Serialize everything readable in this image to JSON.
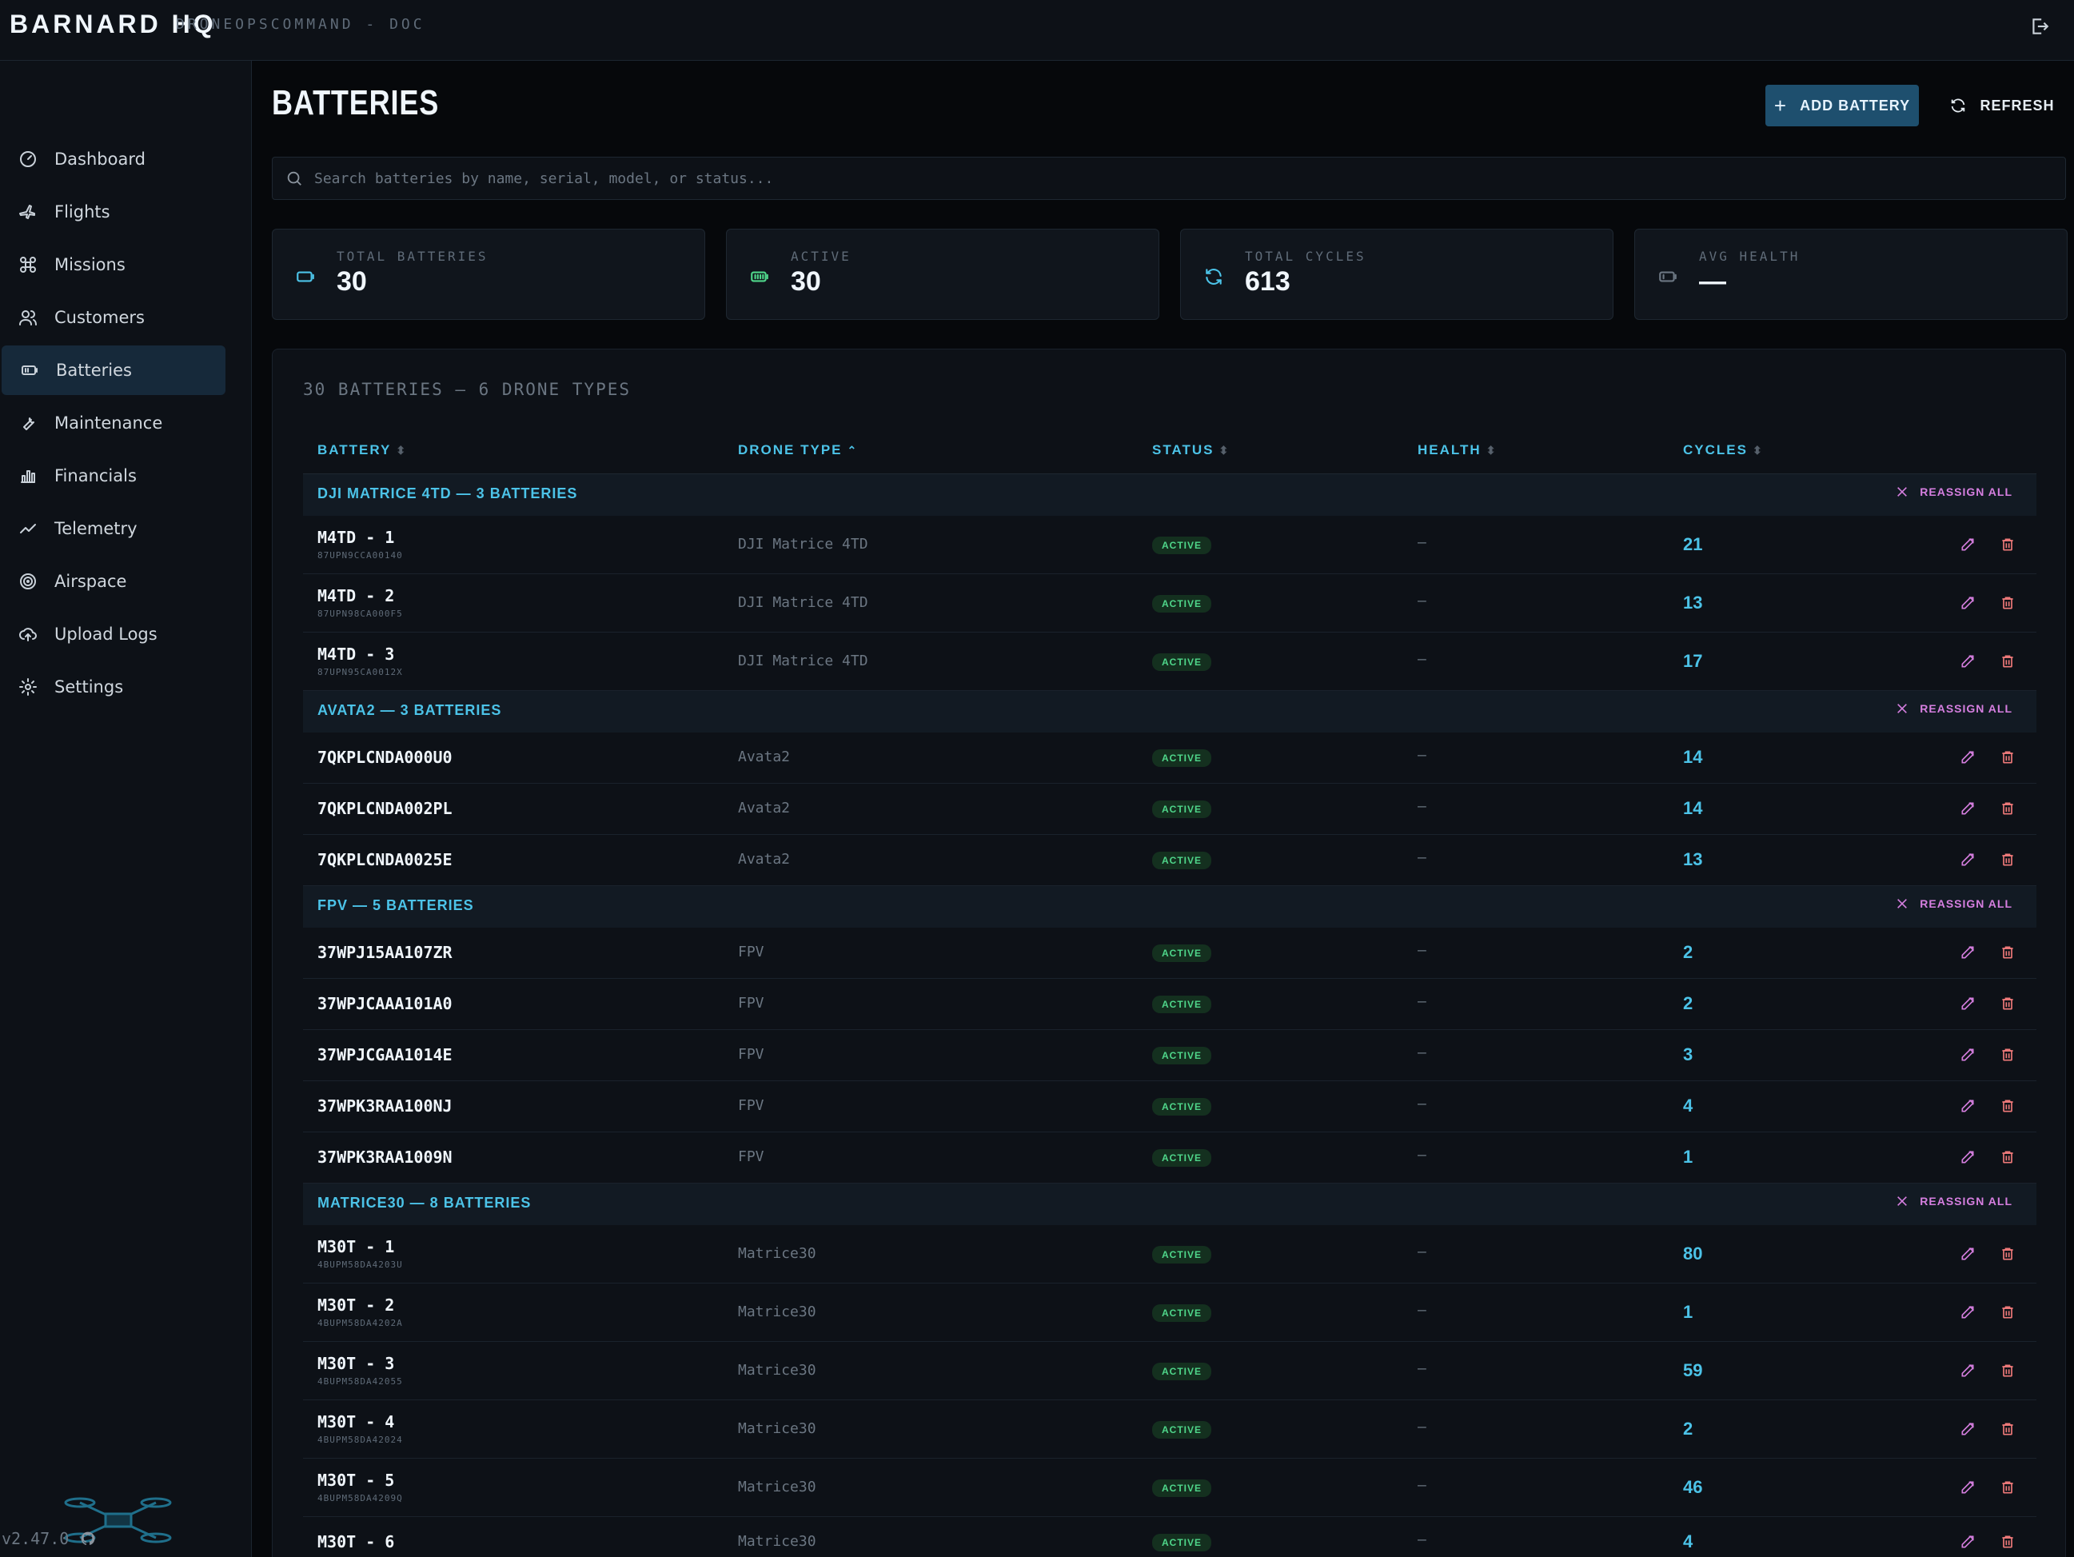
{
  "app": {
    "brand": "BARNARD HQ",
    "subtitle": "DRONEOPSCOMMAND - DOC",
    "version": "v2.47.0"
  },
  "sidebar": {
    "items": [
      {
        "label": "Dashboard",
        "icon": "gauge-icon"
      },
      {
        "label": "Flights",
        "icon": "plane-icon"
      },
      {
        "label": "Missions",
        "icon": "drone-icon"
      },
      {
        "label": "Customers",
        "icon": "users-icon"
      },
      {
        "label": "Batteries",
        "icon": "battery-icon",
        "active": true
      },
      {
        "label": "Maintenance",
        "icon": "wrench-icon"
      },
      {
        "label": "Financials",
        "icon": "bar-chart-icon"
      },
      {
        "label": "Telemetry",
        "icon": "trend-icon"
      },
      {
        "label": "Airspace",
        "icon": "radar-icon"
      },
      {
        "label": "Upload Logs",
        "icon": "cloud-upload-icon"
      },
      {
        "label": "Settings",
        "icon": "gear-icon"
      }
    ]
  },
  "header": {
    "title": "BATTERIES",
    "add_label": "ADD BATTERY",
    "refresh_label": "REFRESH"
  },
  "search": {
    "placeholder": "Search batteries by name, serial, model, or status...",
    "value": ""
  },
  "stats": [
    {
      "label": "TOTAL BATTERIES",
      "value": "30",
      "icon": "battery-outline-icon",
      "color": "#4cc3e8"
    },
    {
      "label": "ACTIVE",
      "value": "30",
      "icon": "battery-full-icon",
      "color": "#4fd68a"
    },
    {
      "label": "TOTAL CYCLES",
      "value": "613",
      "icon": "refresh-icon",
      "color": "#4cc3e8"
    },
    {
      "label": "AVG HEALTH",
      "value": "—",
      "icon": "battery-low-icon",
      "color": "#6b7682"
    }
  ],
  "table": {
    "summary": "30 BATTERIES — 6 DRONE TYPES",
    "columns": [
      "BATTERY",
      "DRONE TYPE",
      "STATUS",
      "HEALTH",
      "CYCLES"
    ],
    "reassign_label": "REASSIGN ALL",
    "groups": [
      {
        "title": "DJI MATRICE 4TD — 3 BATTERIES",
        "rows": [
          {
            "name": "M4TD - 1",
            "serial": "87UPN9CCA00140",
            "type": "DJI Matrice 4TD",
            "status": "ACTIVE",
            "health": "—",
            "cycles": "21"
          },
          {
            "name": "M4TD - 2",
            "serial": "87UPN98CA000F5",
            "type": "DJI Matrice 4TD",
            "status": "ACTIVE",
            "health": "—",
            "cycles": "13"
          },
          {
            "name": "M4TD - 3",
            "serial": "87UPN95CA0012X",
            "type": "DJI Matrice 4TD",
            "status": "ACTIVE",
            "health": "—",
            "cycles": "17"
          }
        ]
      },
      {
        "title": "AVATA2 — 3 BATTERIES",
        "rows": [
          {
            "name": "7QKPLCNDA000U0",
            "serial": "",
            "type": "Avata2",
            "status": "ACTIVE",
            "health": "—",
            "cycles": "14"
          },
          {
            "name": "7QKPLCNDA002PL",
            "serial": "",
            "type": "Avata2",
            "status": "ACTIVE",
            "health": "—",
            "cycles": "14"
          },
          {
            "name": "7QKPLCNDA0025E",
            "serial": "",
            "type": "Avata2",
            "status": "ACTIVE",
            "health": "—",
            "cycles": "13"
          }
        ]
      },
      {
        "title": "FPV — 5 BATTERIES",
        "rows": [
          {
            "name": "37WPJ15AA107ZR",
            "serial": "",
            "type": "FPV",
            "status": "ACTIVE",
            "health": "—",
            "cycles": "2"
          },
          {
            "name": "37WPJCAAA101A0",
            "serial": "",
            "type": "FPV",
            "status": "ACTIVE",
            "health": "—",
            "cycles": "2"
          },
          {
            "name": "37WPJCGAA1014E",
            "serial": "",
            "type": "FPV",
            "status": "ACTIVE",
            "health": "—",
            "cycles": "3"
          },
          {
            "name": "37WPK3RAA100NJ",
            "serial": "",
            "type": "FPV",
            "status": "ACTIVE",
            "health": "—",
            "cycles": "4"
          },
          {
            "name": "37WPK3RAA1009N",
            "serial": "",
            "type": "FPV",
            "status": "ACTIVE",
            "health": "—",
            "cycles": "1"
          }
        ]
      },
      {
        "title": "MATRICE30 — 8 BATTERIES",
        "rows": [
          {
            "name": "M30T - 1",
            "serial": "4BUPM58DA4203U",
            "type": "Matrice30",
            "status": "ACTIVE",
            "health": "—",
            "cycles": "80"
          },
          {
            "name": "M30T - 2",
            "serial": "4BUPM58DA4202A",
            "type": "Matrice30",
            "status": "ACTIVE",
            "health": "—",
            "cycles": "1"
          },
          {
            "name": "M30T - 3",
            "serial": "4BUPM58DA42055",
            "type": "Matrice30",
            "status": "ACTIVE",
            "health": "—",
            "cycles": "59"
          },
          {
            "name": "M30T - 4",
            "serial": "4BUPM58DA42024",
            "type": "Matrice30",
            "status": "ACTIVE",
            "health": "—",
            "cycles": "2"
          },
          {
            "name": "M30T - 5",
            "serial": "4BUPM58DA4209Q",
            "type": "Matrice30",
            "status": "ACTIVE",
            "health": "—",
            "cycles": "46"
          },
          {
            "name": "M30T - 6",
            "serial": "",
            "type": "Matrice30",
            "status": "ACTIVE",
            "health": "—",
            "cycles": "4"
          }
        ]
      }
    ]
  },
  "colors": {
    "accent": "#4cc3e8",
    "active_badge_bg": "#14301f",
    "active_badge_fg": "#4fd68a",
    "reassign": "#d67fe0",
    "delete": "#f07a7a",
    "primary_button": "#1e4f6e"
  }
}
